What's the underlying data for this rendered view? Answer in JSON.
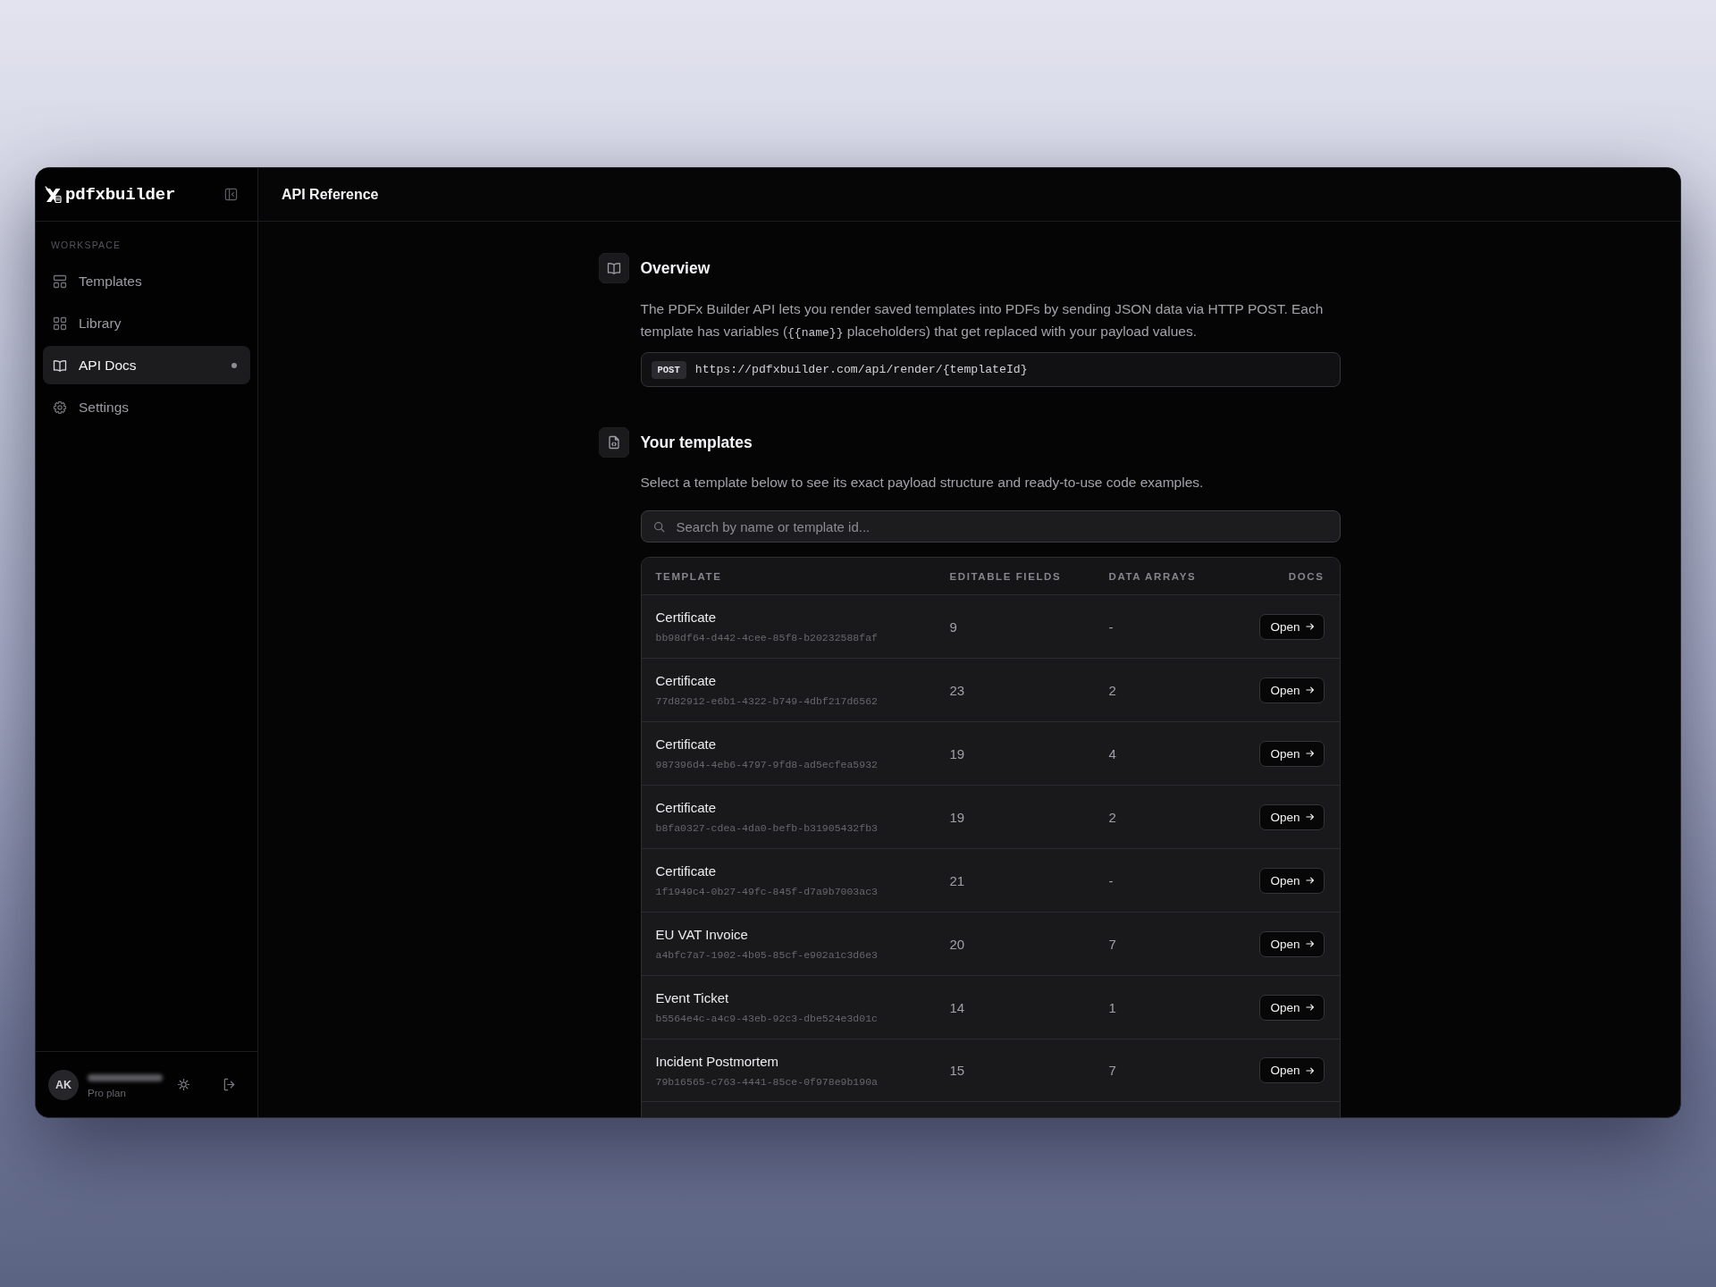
{
  "sidebar": {
    "logo": "pdfxbuilder",
    "section_label": "WORKSPACE",
    "items": [
      {
        "label": "Templates",
        "selected": false
      },
      {
        "label": "Library",
        "selected": false
      },
      {
        "label": "API Docs",
        "selected": true
      },
      {
        "label": "Settings",
        "selected": false
      }
    ],
    "user": {
      "initials": "AK",
      "plan": "Pro plan"
    }
  },
  "header": {
    "title": "API Reference"
  },
  "overview": {
    "title": "Overview",
    "description": [
      {
        "kind": "text",
        "text": "The PDFx Builder API lets you render saved templates into PDFs by sending JSON data via HTTP POST. Each template has variables ("
      },
      {
        "kind": "code",
        "text": "{{name}}"
      },
      {
        "kind": "text",
        "text": " placeholders) that get replaced with your payload values."
      }
    ],
    "endpoint": {
      "method": "POST",
      "url": "https://pdfxbuilder.com/api/render/{templateId}"
    }
  },
  "templates": {
    "title": "Your templates",
    "description": "Select a template below to see its exact payload structure and ready-to-use code examples.",
    "search": {
      "placeholder": "Search by name or template id..."
    },
    "table": {
      "columns": [
        "TEMPLATE",
        "EDITABLE FIELDS",
        "DATA ARRAYS",
        "DOCS"
      ],
      "rows": [
        {
          "name": "Certificate",
          "id": "bb98df64-d442-4cee-85f8-b20232588faf",
          "editable_fields": "9",
          "data_arrays": "-",
          "docs": "Open"
        },
        {
          "name": "Certificate",
          "id": "77d82912-e6b1-4322-b749-4dbf217d6562",
          "editable_fields": "23",
          "data_arrays": "2",
          "docs": "Open"
        },
        {
          "name": "Certificate",
          "id": "987396d4-4eb6-4797-9fd8-ad5ecfea5932",
          "editable_fields": "19",
          "data_arrays": "4",
          "docs": "Open"
        },
        {
          "name": "Certificate",
          "id": "b8fa0327-cdea-4da0-befb-b31905432fb3",
          "editable_fields": "19",
          "data_arrays": "2",
          "docs": "Open"
        },
        {
          "name": "Certificate",
          "id": "1f1949c4-0b27-49fc-845f-d7a9b7003ac3",
          "editable_fields": "21",
          "data_arrays": "-",
          "docs": "Open"
        },
        {
          "name": "EU VAT Invoice",
          "id": "a4bfc7a7-1902-4b05-85cf-e902a1c3d6e3",
          "editable_fields": "20",
          "data_arrays": "7",
          "docs": "Open"
        },
        {
          "name": "Event Ticket",
          "id": "b5564e4c-a4c9-43eb-92c3-dbe524e3d01c",
          "editable_fields": "14",
          "data_arrays": "1",
          "docs": "Open"
        },
        {
          "name": "Incident Postmortem",
          "id": "79b16565-c763-4441-85ce-0f978e9b190a",
          "editable_fields": "15",
          "data_arrays": "7",
          "docs": "Open"
        }
      ]
    }
  }
}
